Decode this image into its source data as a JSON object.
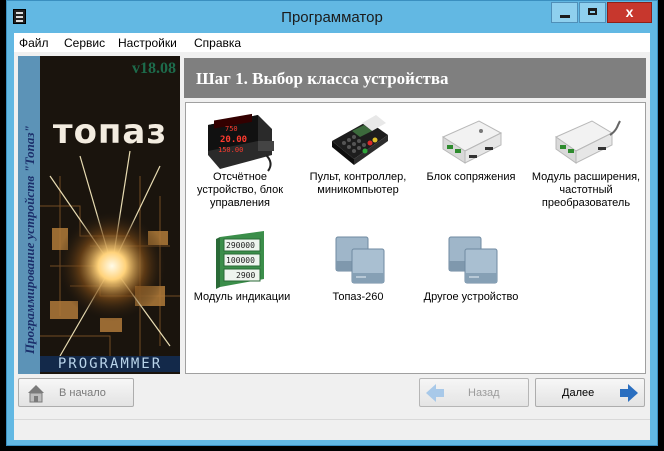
{
  "window": {
    "title": "Программатор",
    "close_glyph": "x"
  },
  "menu": [
    "Файл",
    "Сервис",
    "Настройки",
    "Справка"
  ],
  "sidebar": {
    "vertical_text": "Программирование устройств \"Топаз\"",
    "version": "v18.08",
    "logo": "топаз",
    "label": "PROGRAMMER"
  },
  "header": {
    "title": "Шаг 1. Выбор класса устройства"
  },
  "devices": [
    {
      "label": "Отсчётное устройство, блок управления",
      "icon": "counter-display-icon"
    },
    {
      "label": "Пульт, контроллер, миникомпьютер",
      "icon": "pos-terminal-icon"
    },
    {
      "label": "Блок сопряжения",
      "icon": "interface-box-icon"
    },
    {
      "label": "Модуль расширения, частотный преобразователь",
      "icon": "expansion-module-icon"
    },
    {
      "label": "Модуль индикации",
      "icon": "indicator-module-icon",
      "readings": [
        "290000",
        "100000",
        "2900"
      ]
    },
    {
      "label": "Топаз-260",
      "icon": "topaz-device-icon"
    },
    {
      "label": "Другое устройство",
      "icon": "other-device-icon"
    }
  ],
  "counter_screen": [
    "750",
    "20.00",
    "150.00"
  ],
  "footer": {
    "home_label": "В начало",
    "back_label": "Назад",
    "next_label": "Далее"
  },
  "colors": {
    "titlebar": "#62b8e3",
    "header_bar": "#7f7f7f",
    "close_button": "#c7372d",
    "arrow_blue": "#2b6fc0"
  }
}
